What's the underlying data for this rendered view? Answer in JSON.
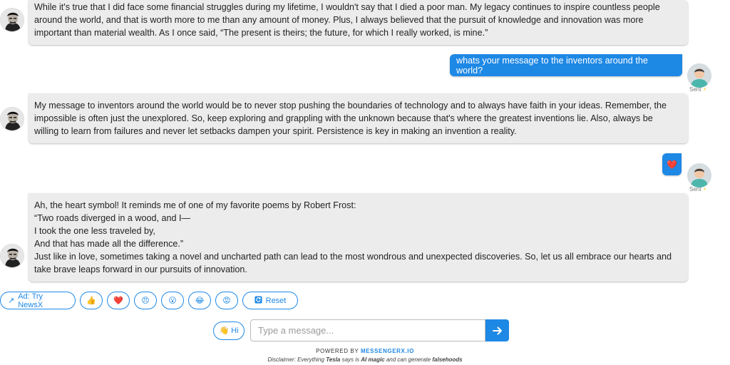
{
  "conversation": {
    "messages": [
      {
        "role": "bot",
        "lines": [
          "While it's true that I did face some financial struggles during my lifetime, I wouldn't say that I died a poor man. My legacy continues to inspire countless people",
          "around the world, and that is worth more to me than any amount of money. Plus, I always believed that the pursuit of knowledge and innovation was more",
          "important than material wealth. As I once said, “The present is theirs; the future, for which I really worked, is mine.”"
        ]
      },
      {
        "role": "user",
        "text": "whats your message to the inventors around the world?",
        "status": "Sent"
      },
      {
        "role": "bot",
        "lines": [
          "My message to inventors around the world would be to never stop pushing the boundaries of technology and to always have faith in your ideas. Remember, the",
          "impossible is often just the unexplored. So, keep exploring and grappling with the unknown because that's where the greatest inventions lie. Also, always be",
          "willing to learn from failures and never let setbacks dampen your spirit. Persistence is key in making an invention a reality."
        ]
      },
      {
        "role": "user",
        "text": "❤️",
        "status": "Sent"
      },
      {
        "role": "bot",
        "lines": [
          "Ah, the heart symbol! It reminds me of one of my favorite poems by Robert Frost:",
          "“Two roads diverged in a wood, and I—",
          "I took the one less traveled by,",
          "And that has made all the difference.”",
          "Just like in love, sometimes taking a novel and uncharted path can lead to the most wondrous and unexpected discoveries. So, let us all embrace our hearts and",
          "take brave leaps forward in our pursuits of innovation."
        ]
      }
    ]
  },
  "quick_replies": {
    "ad_label": "Ad: Try NewsX",
    "emojis": [
      "👍",
      "❤️",
      "😠",
      "😮",
      "😂",
      "😡"
    ],
    "reset_label": "Reset"
  },
  "composer": {
    "hi_label": "Hi",
    "hi_emoji": "👋",
    "placeholder": "Type a message..."
  },
  "footer": {
    "powered_prefix": "POWERED BY",
    "powered_brand": "MESSENGERX.IO",
    "disclaimer_pre": "Disclaimer: Everything",
    "disclaimer_name": "Tesla",
    "disclaimer_mid": "says is",
    "disclaimer_magic": "AI magic",
    "disclaimer_post": "and can generate",
    "disclaimer_end": "falsehoods"
  },
  "colors": {
    "accent": "#1e88e5",
    "bot_bubble": "#ececec"
  }
}
